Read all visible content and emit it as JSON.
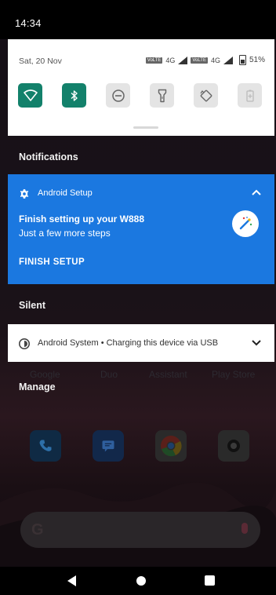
{
  "status_bar": {
    "time": "14:34"
  },
  "quick_settings": {
    "date": "Sat, 20 Nov",
    "sim1": {
      "volte_label": "VoLTE",
      "network": "4G"
    },
    "sim2": {
      "volte_label": "VoLTE",
      "network": "4G"
    },
    "battery_percent": "51%",
    "tiles": [
      {
        "icon": "wifi-icon",
        "state": "on"
      },
      {
        "icon": "bluetooth-icon",
        "state": "on"
      },
      {
        "icon": "do-not-disturb-icon",
        "state": "off"
      },
      {
        "icon": "flashlight-icon",
        "state": "off"
      },
      {
        "icon": "auto-rotate-icon",
        "state": "off"
      },
      {
        "icon": "battery-saver-icon",
        "state": "off"
      }
    ],
    "accent_color": "#13816b"
  },
  "notifications_label": "Notifications",
  "setup_notification": {
    "app_name": "Android Setup",
    "title": "Finish setting up your W888",
    "body": "Just a few more steps",
    "action": "FINISH SETUP",
    "color": "#1b78e0"
  },
  "silent_label": "Silent",
  "system_notification": {
    "text": "Android System • Charging this device via USB"
  },
  "manage_label": "Manage",
  "background_apps": [
    "Google",
    "Duo",
    "Assistant",
    "Play Store"
  ]
}
